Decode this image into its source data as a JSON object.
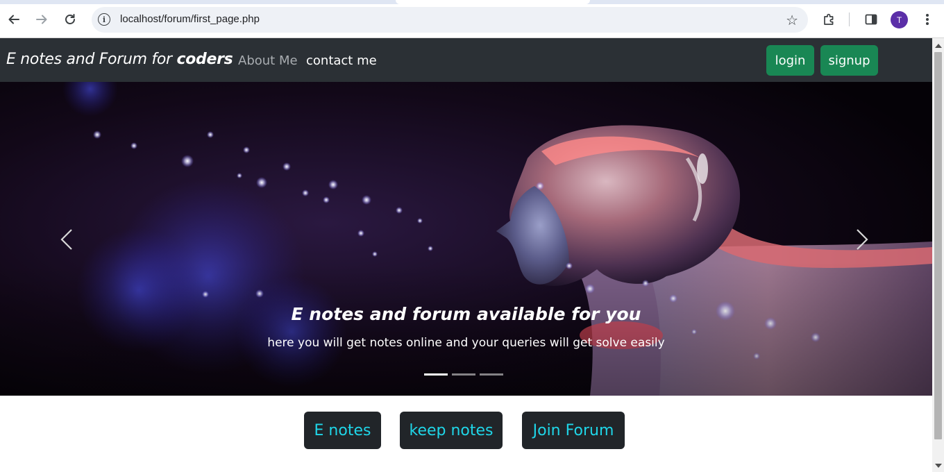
{
  "browser": {
    "url": "localhost/forum/first_page.php",
    "profile_initial": "T",
    "icons": {
      "back": "arrow-left-icon",
      "forward": "arrow-right-icon",
      "reload": "reload-icon",
      "site_info": "info-icon",
      "bookmark": "star-icon",
      "extensions": "puzzle-icon",
      "side_panel": "side-panel-icon",
      "menu": "kebab-menu-icon"
    }
  },
  "navbar": {
    "brand_prefix": "E notes and Forum for ",
    "brand_bold": "coders",
    "links": [
      "About Me",
      "contact me"
    ],
    "login_label": "login",
    "signup_label": "signup",
    "colors": {
      "background": "#2b3035",
      "button": "#198754"
    }
  },
  "carousel": {
    "caption_title": "E notes and forum available for you",
    "caption_text": "here you will get notes online and your queries will get solve easily",
    "slide_count": 3,
    "active_slide": 1,
    "icons": {
      "prev": "chevron-left-icon",
      "next": "chevron-right-icon"
    }
  },
  "actions": {
    "buttons": [
      "E notes",
      "keep notes",
      "Join Forum"
    ],
    "colors": {
      "background": "#212529",
      "text": "#1fd6e8"
    }
  }
}
